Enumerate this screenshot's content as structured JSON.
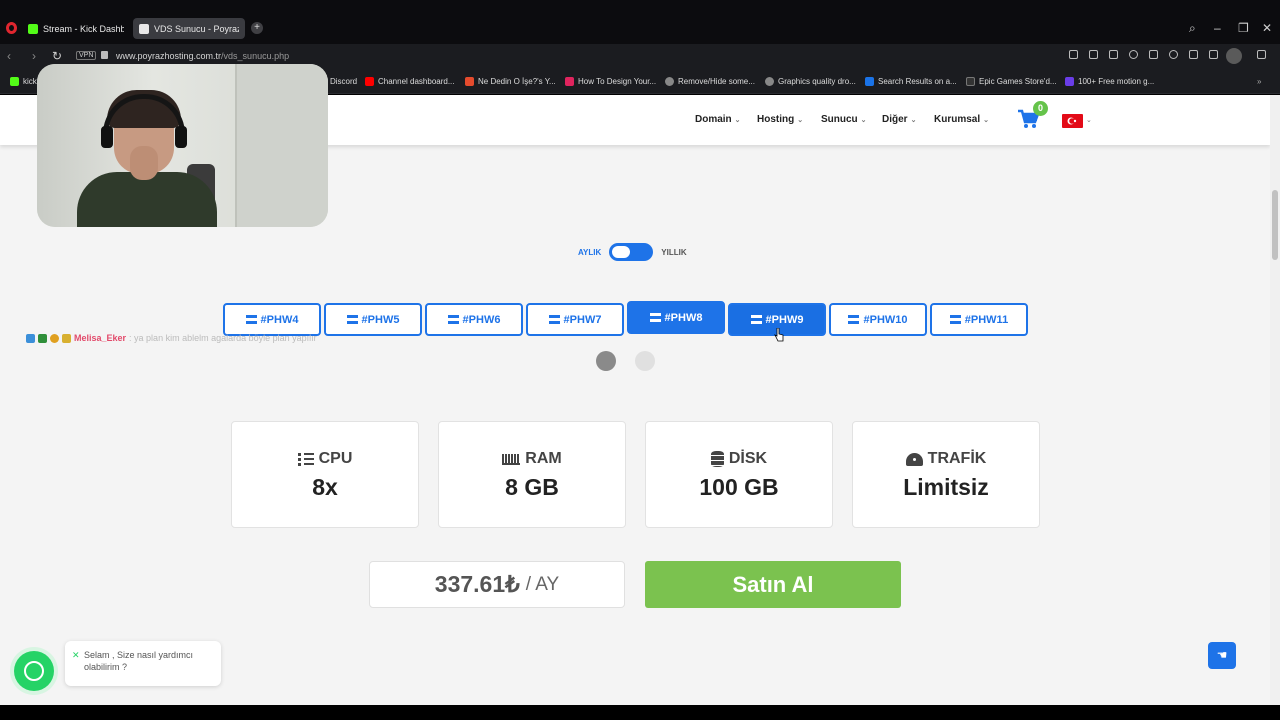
{
  "browser": {
    "tabs": [
      {
        "label": "Stream - Kick Dashboard"
      },
      {
        "label": "VDS Sunucu - Poyraz Hos"
      }
    ],
    "url_host": "www.poyrazhosting.com.tr",
    "url_path": "/vds_sunucu.php",
    "vpn_label": "VPN",
    "bookmarks": [
      {
        "label": "kick",
        "color": "#53fc18"
      },
      {
        "label": "Discord",
        "color": "#5865f2"
      },
      {
        "label": "Channel dashboard...",
        "color": "#ff0000"
      },
      {
        "label": "Ne Dedin O İşe?'s Y...",
        "color": "#e54b2d"
      },
      {
        "label": "How To Design Your...",
        "color": "#e0245e"
      },
      {
        "label": "Remove/Hide some...",
        "color": "#888888"
      },
      {
        "label": "Graphics quality dro...",
        "color": "#888888"
      },
      {
        "label": "Search Results on a...",
        "color": "#1a73e8"
      },
      {
        "label": "Epic Games Store'd...",
        "color": "#333333"
      },
      {
        "label": "100+ Free motion g...",
        "color": "#6a3de8"
      }
    ]
  },
  "header": {
    "menu": [
      {
        "label": "Domain"
      },
      {
        "label": "Hosting"
      },
      {
        "label": "Sunucu"
      },
      {
        "label": "Diğer"
      },
      {
        "label": "Kurumsal"
      }
    ],
    "cart_count": "0"
  },
  "billing": {
    "monthly_label": "AYLIK",
    "yearly_label": "YILLIK"
  },
  "plans": [
    {
      "label": "#PHW4"
    },
    {
      "label": "#PHW5"
    },
    {
      "label": "#PHW6"
    },
    {
      "label": "#PHW7"
    },
    {
      "label": "#PHW8"
    },
    {
      "label": "#PHW9"
    },
    {
      "label": "#PHW10"
    },
    {
      "label": "#PHW11"
    }
  ],
  "chat_overlay": {
    "user": "Melisa_Eker",
    "message": ": ya plan kim ablelm agalarda böyle plan yapılır"
  },
  "specs": [
    {
      "label": "CPU",
      "value": "8x",
      "icon": "cpu-list-icon"
    },
    {
      "label": "RAM",
      "value": "8 GB",
      "icon": "memory-icon"
    },
    {
      "label": "DİSK",
      "value": "100 GB",
      "icon": "database-icon"
    },
    {
      "label": "TRAFİK",
      "value": "Limitsiz",
      "icon": "gauge-icon"
    }
  ],
  "pricing": {
    "price": "337.61₺",
    "period": "/ AY",
    "buy_label": "Satın Al"
  },
  "whatsapp": {
    "message": "Selam , Size nasıl yardımcı olabilirim ?"
  },
  "colors": {
    "primary": "#1e73e8",
    "buy": "#7bc24f",
    "whatsapp": "#25d366"
  }
}
